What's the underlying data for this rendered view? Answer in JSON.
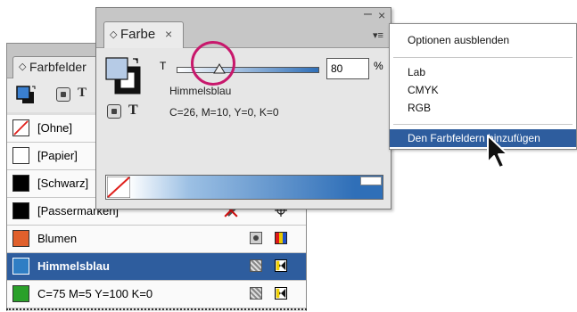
{
  "swatches_panel": {
    "tab_label": "Farbfelder",
    "toolbar_text_icon": "T",
    "rows": [
      {
        "name": "[Ohne]",
        "chip": "none"
      },
      {
        "name": "[Papier]",
        "chip": "#ffffff"
      },
      {
        "name": "[Schwarz]",
        "chip": "#000000"
      },
      {
        "name": "[Passermarken]",
        "chip": "#000000"
      },
      {
        "name": "Blumen",
        "chip": "#e0602c"
      },
      {
        "name": "Himmelsblau",
        "chip": "#2f7ec4"
      },
      {
        "name": "C=75 M=5 Y=100 K=0",
        "chip": "#2aa02a"
      }
    ],
    "selected_color": "#2e5d9e"
  },
  "color_panel": {
    "tab_label": "Farbe",
    "close_glyph": "×",
    "minimize_glyph": "–",
    "window_close_glyph": "×",
    "menu_glyph": "▾≡",
    "tint_label": "T",
    "tint_value": "80",
    "tint_unit": "%",
    "tint_level": 0.8,
    "swatch_name": "Himmelsblau",
    "swatch_values": "C=26, M=10, Y=0, K=0",
    "fill_color": "#b6cbe6",
    "text_icon": "T"
  },
  "flyout_menu": {
    "items": [
      {
        "label": "Optionen ausblenden"
      },
      {
        "label": "Lab"
      },
      {
        "label": "CMYK"
      },
      {
        "label": "RGB"
      },
      {
        "label": "Den Farbfeldern hinzufügen",
        "highlighted": true
      }
    ],
    "highlight_color": "#2e5d9e"
  },
  "annotation": {
    "circle_color": "#c8186c"
  }
}
